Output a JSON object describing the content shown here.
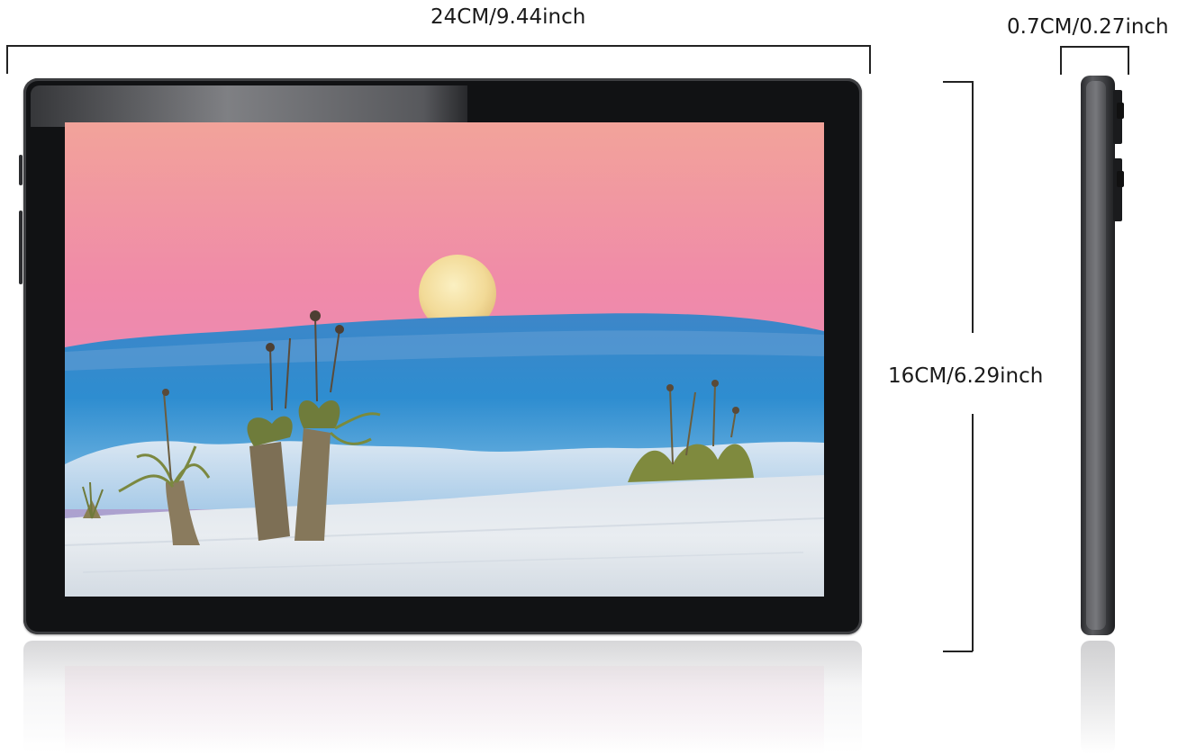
{
  "dimensions": {
    "width_label": "24CM/9.44inch",
    "depth_label": "0.7CM/0.27inch",
    "height_label": "16CM/6.29inch"
  },
  "colors": {
    "bezel": "#111214",
    "frame": "#3d3e41",
    "sky_top": "#f39aa6",
    "sky_mid": "#ea7fb0",
    "cloud_blue": "#2f8fcf",
    "moon": "#f6e2a5",
    "sand": "#e8ecef"
  },
  "icons": {
    "front_side_buttons": "button-icon",
    "side_profile_keys": "volume-key-icon"
  }
}
